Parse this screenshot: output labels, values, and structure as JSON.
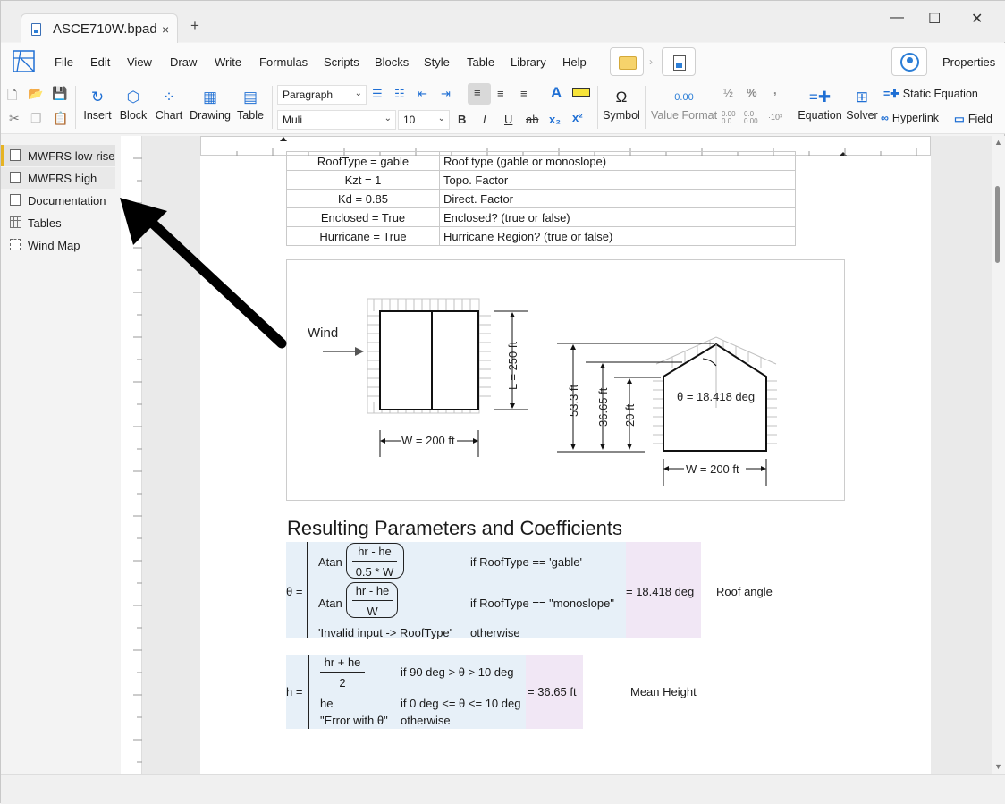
{
  "window": {
    "tab_title": "ASCE710W.bpad",
    "tab_close": "×",
    "new_tab": "+",
    "minimize": "—",
    "maximize": "☐",
    "close": "✕"
  },
  "menu": [
    "File",
    "Edit",
    "View",
    "Draw",
    "Write",
    "Formulas",
    "Scripts",
    "Blocks",
    "Style",
    "Table",
    "Library",
    "Help"
  ],
  "properties_label": "Properties",
  "toolbar": {
    "insert": [
      "Insert",
      "Block",
      "Chart",
      "Drawing",
      "Table"
    ],
    "paragraph_style": "Paragraph",
    "font": "Muli",
    "font_size": "10",
    "symbol_label": "Symbol",
    "symbol_glyph": "Ω",
    "value_format_label": "Value Format",
    "value_format_glyph": "0.00",
    "equation_label": "Equation",
    "solver_label": "Solver",
    "static_equation_label": "Static Equation",
    "hyperlink_label": "Hyperlink",
    "field_label": "Field",
    "bold": "B",
    "italic": "I",
    "underline": "U",
    "strike": "ab",
    "subscript": "x₂",
    "superscript": "x²",
    "frac_glyph": "½",
    "percent_glyph": "%",
    "comma_glyph": ","
  },
  "sidebar": {
    "items": [
      {
        "label": "MWFRS low-rise",
        "icon": "page-icon"
      },
      {
        "label": "MWFRS high",
        "icon": "page-icon"
      },
      {
        "label": "Documentation",
        "icon": "page-icon"
      },
      {
        "label": "Tables",
        "icon": "table-grid-icon"
      },
      {
        "label": "Wind Map",
        "icon": "map-frame-icon"
      }
    ]
  },
  "params_table": [
    [
      "RoofType = gable",
      "Roof type (gable or monoslope)"
    ],
    [
      "Kzt = 1",
      "Topo. Factor"
    ],
    [
      "Kd = 0.85",
      "Direct. Factor"
    ],
    [
      "Enclosed = True",
      "Enclosed? (true or false)"
    ],
    [
      "Hurricane = True",
      "Hurricane Region? (true or false)"
    ]
  ],
  "figure": {
    "wind": "Wind",
    "L_label": "L = 250 ft",
    "W_label_plan": "W = 200 ft",
    "W_label_elev": "W = 200 ft",
    "h1": "53.3 ft",
    "h2": "36.65 ft",
    "h3": "20 ft",
    "theta": "θ = 18.418 deg"
  },
  "section_title": "Resulting Parameters and Coefficients",
  "theta_eq": {
    "lhs": "θ =",
    "atan": "Atan",
    "num1": "hr - he",
    "den1": "0.5 * W",
    "cond1": "if RoofType == 'gable'",
    "num2": "hr - he",
    "den2": "W",
    "cond2": "if RoofType == \"monoslope\"",
    "err": "'Invalid input -> RoofType'",
    "cond3": "otherwise",
    "result": "= 18.418 deg",
    "desc": "Roof angle"
  },
  "h_eq": {
    "lhs": "h =",
    "num": "hr + he",
    "den": "2",
    "cond1": "if 90 deg > θ > 10 deg",
    "he": "he",
    "cond2": "if 0 deg <= θ <= 10 deg",
    "err": "\"Error with θ\"",
    "cond3": "otherwise",
    "result": "= 36.65 ft",
    "desc": "Mean Height"
  }
}
